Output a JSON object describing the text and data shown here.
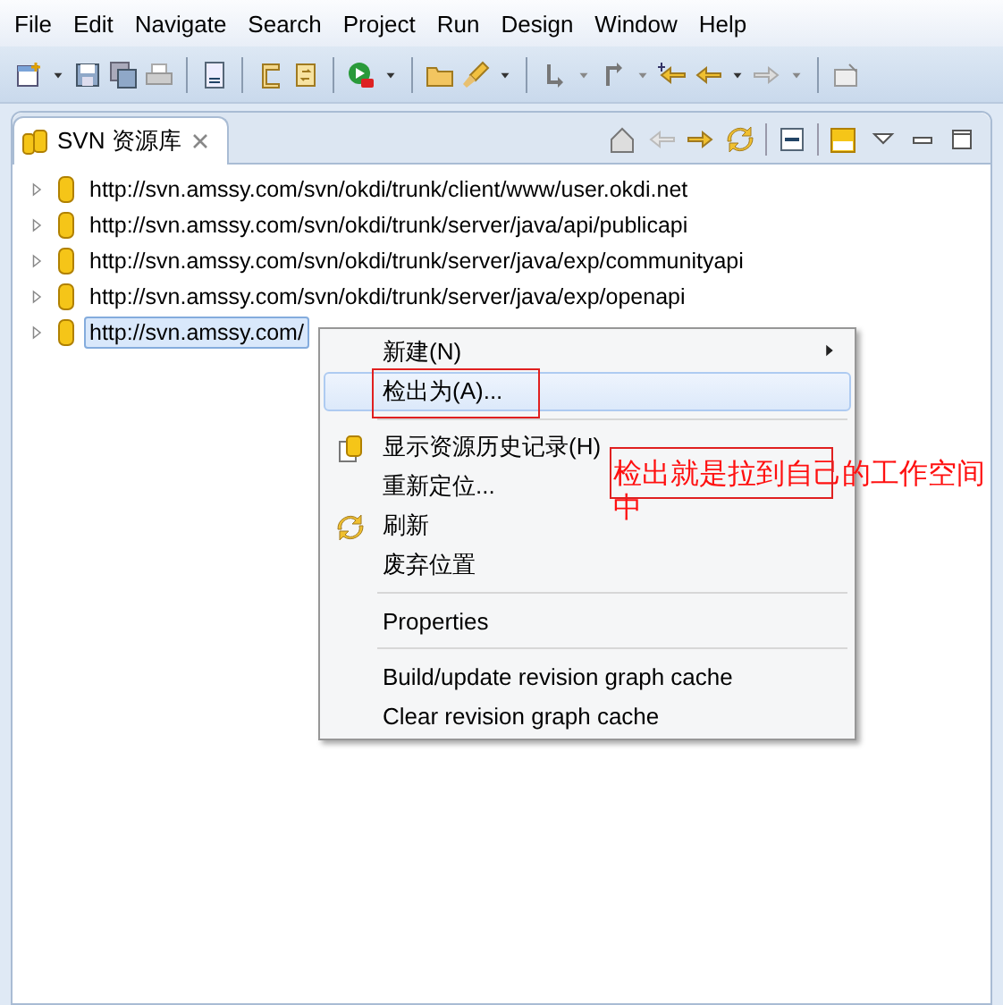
{
  "menu_bar": [
    "File",
    "Edit",
    "Navigate",
    "Search",
    "Project",
    "Run",
    "Design",
    "Window",
    "Help"
  ],
  "view": {
    "tab": {
      "label": "SVN 资源库",
      "selected": true
    },
    "tree": [
      {
        "url": "http://svn.amssy.com/svn/okdi/trunk/client/www/user.okdi.net",
        "selected": false
      },
      {
        "url": "http://svn.amssy.com/svn/okdi/trunk/server/java/api/publicapi",
        "selected": false
      },
      {
        "url": "http://svn.amssy.com/svn/okdi/trunk/server/java/exp/communityapi",
        "selected": false
      },
      {
        "url": "http://svn.amssy.com/svn/okdi/trunk/server/java/exp/openapi",
        "selected": false
      },
      {
        "url": "http://svn.amssy.com/",
        "selected": true
      }
    ]
  },
  "context_menu": [
    {
      "kind": "item",
      "label": "新建(N)",
      "submenu": true,
      "selected": false,
      "marked": false
    },
    {
      "kind": "item",
      "label": "检出为(A)...",
      "selected": true,
      "marked": true
    },
    {
      "kind": "separator"
    },
    {
      "kind": "item",
      "label": "显示资源历史记录(H)",
      "selected": false,
      "marked": false
    },
    {
      "kind": "item",
      "label": "重新定位...",
      "selected": false,
      "marked": false
    },
    {
      "kind": "item",
      "label": "刷新",
      "selected": false,
      "marked": false
    },
    {
      "kind": "item",
      "label": "废弃位置",
      "selected": false,
      "marked": false
    },
    {
      "kind": "separator"
    },
    {
      "kind": "item",
      "label": "Properties",
      "selected": false,
      "marked": false
    },
    {
      "kind": "separator"
    },
    {
      "kind": "item",
      "label": "Build/update revision graph cache",
      "selected": false,
      "marked": false
    },
    {
      "kind": "item",
      "label": "Clear revision graph cache",
      "selected": false,
      "marked": false
    }
  ],
  "callout": {
    "text": "检出就是拉到自己的工作空间中"
  }
}
